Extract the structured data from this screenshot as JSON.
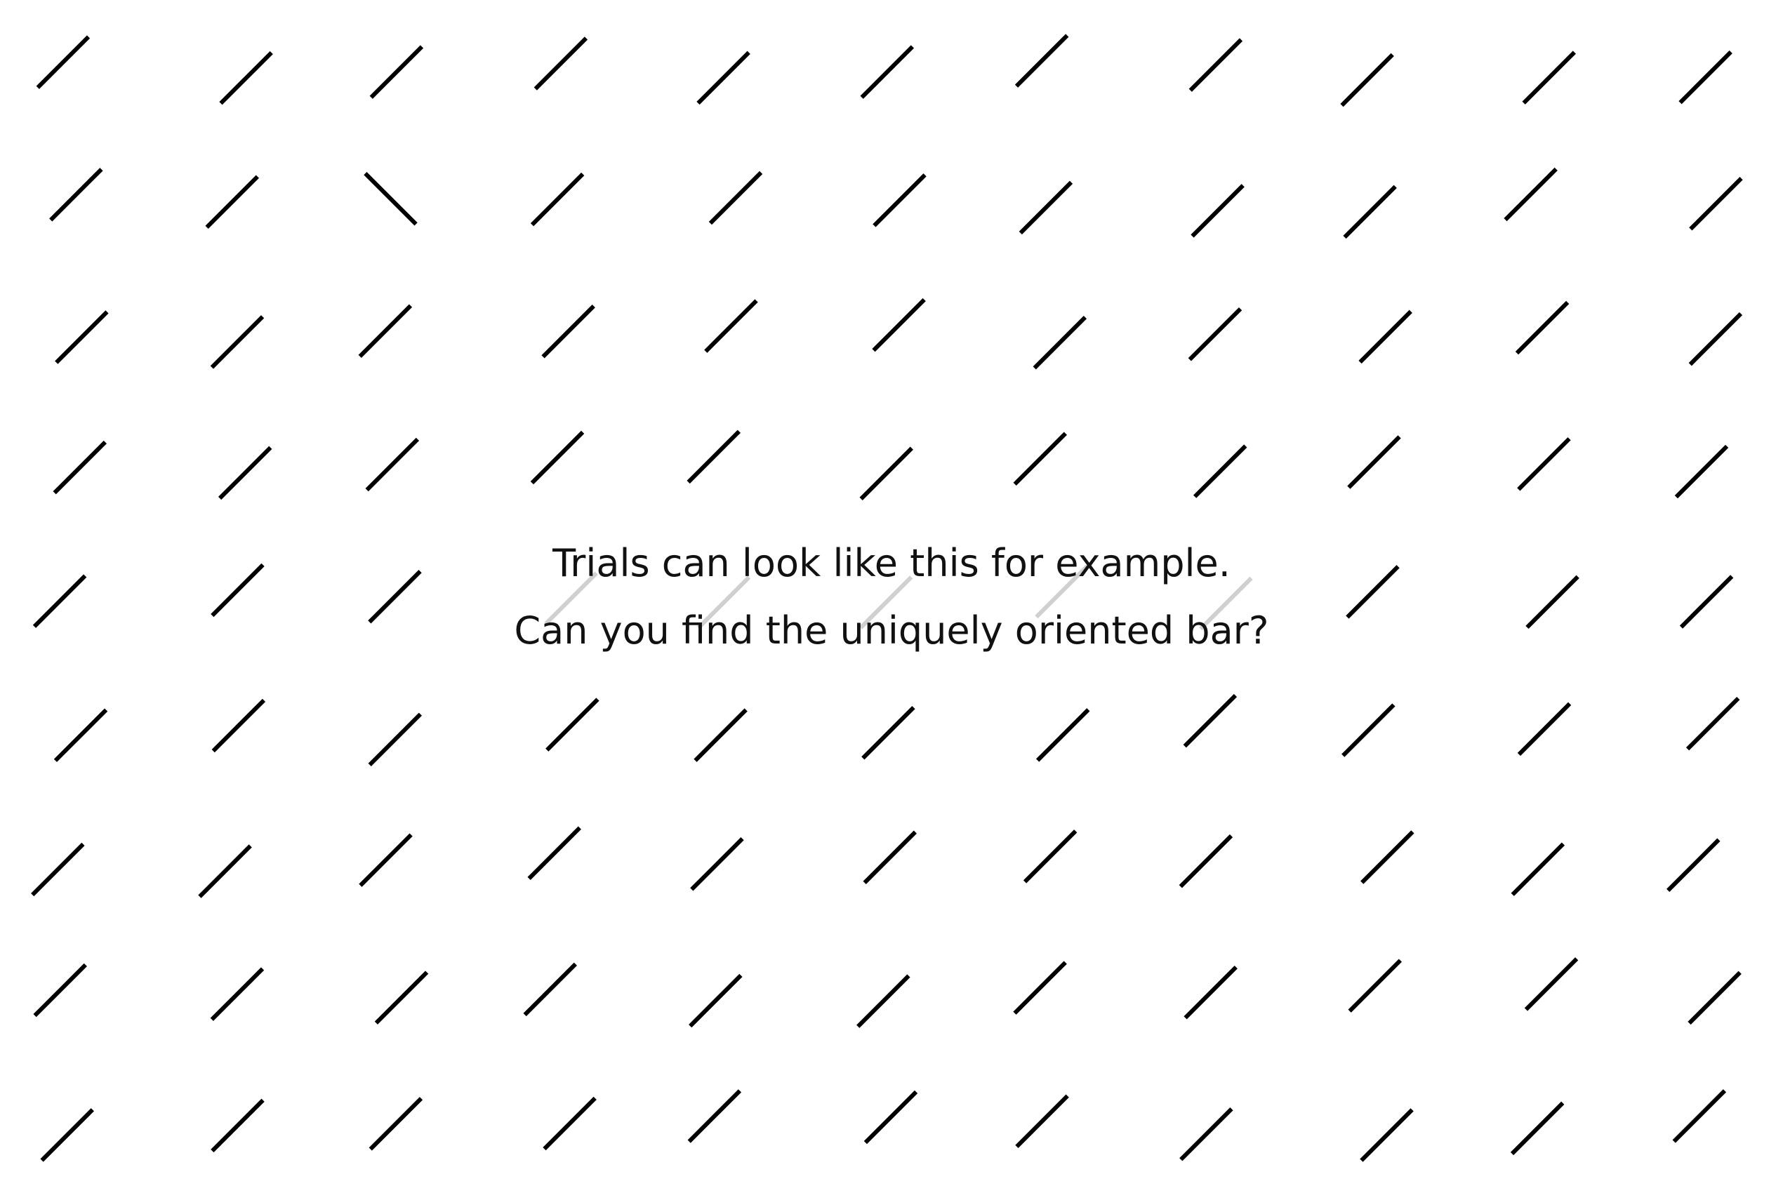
{
  "screen": {
    "instruction_line_1": "Trials can look like this for example.",
    "instruction_line_2": "Can you find the uniquely oriented bar?"
  },
  "stimulus": {
    "bar_color": "#000000",
    "faded_bar_color": "#d0d0d0",
    "distractor_orientation": "right-leaning",
    "target_orientation": "left-leaning",
    "rows": 9,
    "columns": 11
  }
}
